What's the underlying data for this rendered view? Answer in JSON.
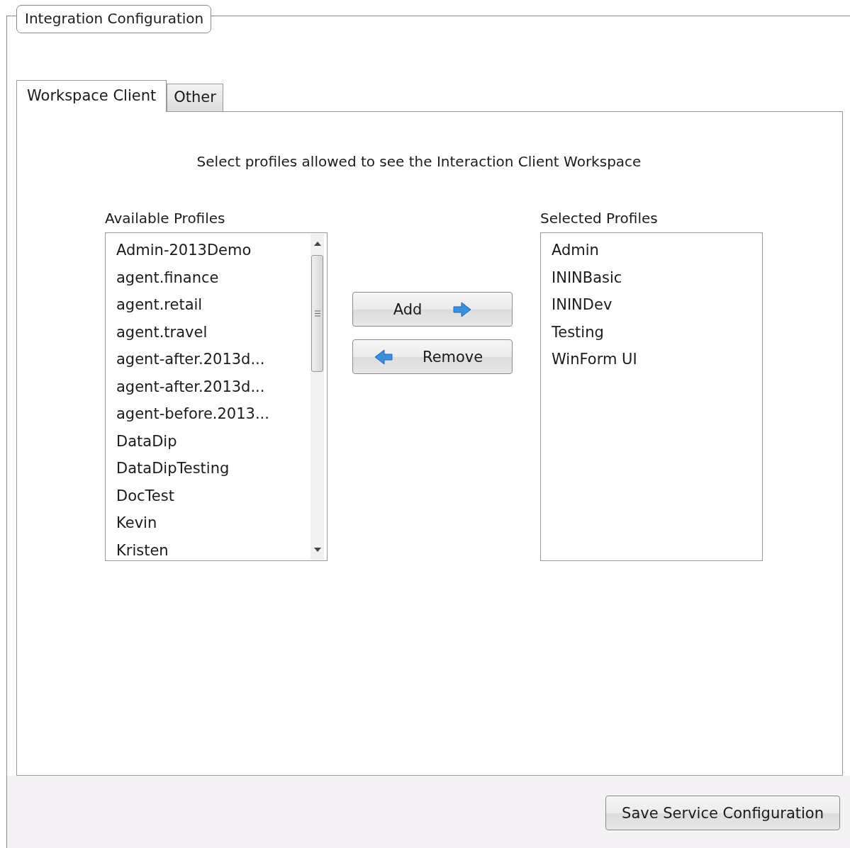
{
  "group": {
    "title": "Integration Configuration"
  },
  "tabs": [
    {
      "label": "Workspace Client",
      "selected": true
    },
    {
      "label": "Other",
      "selected": false
    }
  ],
  "panel": {
    "instruction": "Select profiles allowed to see the Interaction Client Workspace",
    "available": {
      "label": "Available Profiles",
      "items": [
        "Admin-2013Demo",
        "agent.finance",
        "agent.retail",
        "agent.travel",
        "agent-after.2013d...",
        "agent-after.2013d...",
        "agent-before.2013...",
        "DataDip",
        "DataDipTesting",
        "DocTest",
        "Kevin",
        "Kristen"
      ]
    },
    "add_button": "Add",
    "remove_button": "Remove",
    "selected": {
      "label": "Selected Profiles",
      "items": [
        "Admin",
        "ININBasic",
        "ININDev",
        "Testing",
        "WinForm UI"
      ]
    }
  },
  "save_button": "Save Service Configuration"
}
